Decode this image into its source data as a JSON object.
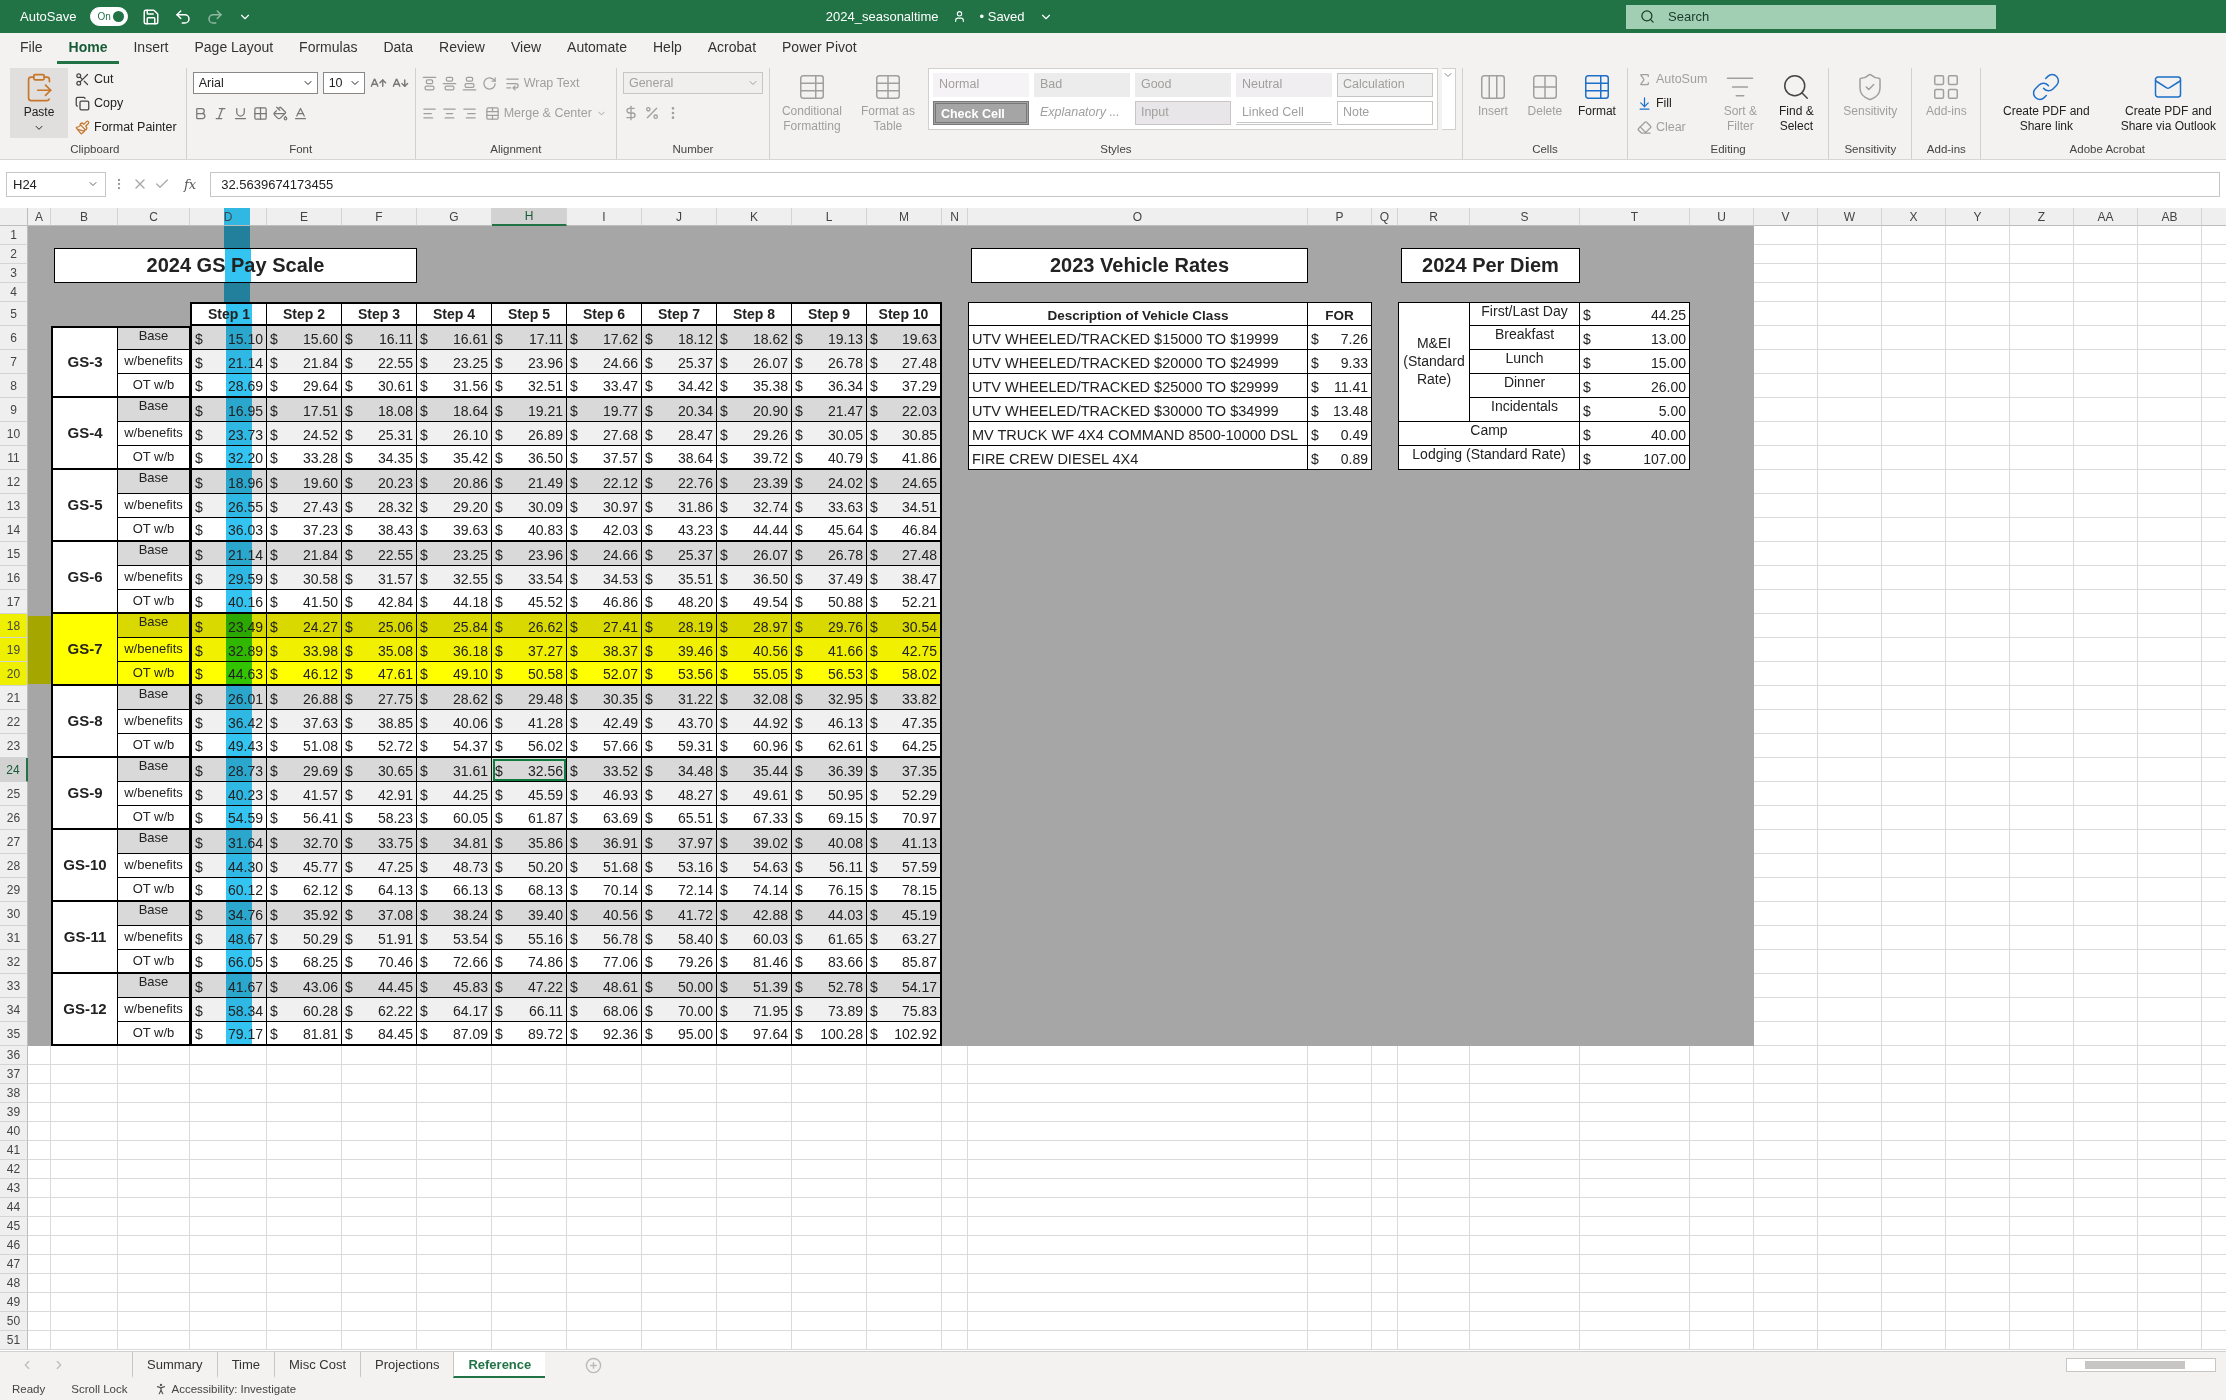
{
  "title_bar": {
    "autosave": "AutoSave",
    "autosave_on": true,
    "toggle_label": "On",
    "filename": "2024_seasonaltime",
    "status": "• Saved",
    "search_placeholder": "Search"
  },
  "ribbon_tabs": [
    {
      "label": "File",
      "selected": false
    },
    {
      "label": "Home",
      "selected": true
    },
    {
      "label": "Insert",
      "selected": false
    },
    {
      "label": "Page Layout",
      "selected": false
    },
    {
      "label": "Formulas",
      "selected": false
    },
    {
      "label": "Data",
      "selected": false
    },
    {
      "label": "Review",
      "selected": false
    },
    {
      "label": "View",
      "selected": false
    },
    {
      "label": "Automate",
      "selected": false
    },
    {
      "label": "Help",
      "selected": false
    },
    {
      "label": "Acrobat",
      "selected": false
    },
    {
      "label": "Power Pivot",
      "selected": false
    }
  ],
  "clipboard": {
    "label": "Clipboard",
    "paste": "Paste",
    "items": [
      {
        "kind": "cut",
        "label": "Cut"
      },
      {
        "kind": "copy",
        "label": "Copy"
      },
      {
        "kind": "painter",
        "label": "Format Painter"
      }
    ]
  },
  "font": {
    "label": "Font",
    "name": "Arial",
    "size": "10"
  },
  "alignment": {
    "label": "Alignment",
    "wrap": "Wrap Text",
    "merge": "Merge & Center",
    "disabled": true
  },
  "number": {
    "label": "Number",
    "format": "General",
    "disabled": true
  },
  "styles": {
    "label": "Styles",
    "buttons": [
      {
        "kind": "conditional",
        "label": "Conditional Formatting",
        "disabled": true
      },
      {
        "kind": "table",
        "label": "Format as Table",
        "disabled": true
      }
    ],
    "gallery": [
      {
        "kind": "normal",
        "label": "Normal"
      },
      {
        "kind": "bad",
        "label": "Bad"
      },
      {
        "kind": "good",
        "label": "Good"
      },
      {
        "kind": "neutral",
        "label": "Neutral"
      },
      {
        "kind": "calculation",
        "label": "Calculation"
      },
      {
        "kind": "check",
        "label": "Check Cell"
      },
      {
        "kind": "explanatory",
        "label": "Explanatory ..."
      },
      {
        "kind": "input",
        "label": "Input"
      },
      {
        "kind": "linked",
        "label": "Linked Cell"
      },
      {
        "kind": "note",
        "label": "Note"
      }
    ]
  },
  "cells": {
    "label": "Cells",
    "buttons": [
      {
        "kind": "insert",
        "label": "Insert",
        "disabled": true
      },
      {
        "kind": "delete",
        "label": "Delete",
        "disabled": true
      },
      {
        "kind": "format",
        "label": "Format",
        "disabled": false
      }
    ]
  },
  "editing": {
    "label": "Editing",
    "items": [
      {
        "kind": "autosum",
        "label": "AutoSum",
        "disabled": true
      },
      {
        "kind": "fill",
        "label": "Fill",
        "disabled": false
      },
      {
        "kind": "clear",
        "label": "Clear",
        "disabled": true
      }
    ],
    "buttons": [
      {
        "kind": "sort",
        "label": "Sort & Filter",
        "disabled": true
      },
      {
        "kind": "find",
        "label": "Find & Select",
        "disabled": false
      }
    ]
  },
  "sensitivity": {
    "label": "Sensitivity",
    "button": "Sensitivity",
    "disabled": true
  },
  "addins": {
    "label": "Add-ins",
    "button": "Add-ins",
    "disabled": true
  },
  "acrobat": {
    "label": "Adobe Acrobat",
    "buttons": [
      {
        "kind": "link",
        "label": "Create PDF and Share link"
      },
      {
        "kind": "outlook",
        "label": "Create PDF and Share via Outlook"
      }
    ]
  },
  "formula_bar": {
    "name_box": "H24",
    "fx": "fx",
    "value": "32.5639674173455"
  },
  "column_headers": [
    {
      "label": "A",
      "selected": false
    },
    {
      "label": "B",
      "selected": false
    },
    {
      "label": "C",
      "selected": false
    },
    {
      "label": "D",
      "selected": false
    },
    {
      "label": "E",
      "selected": false
    },
    {
      "label": "F",
      "selected": false
    },
    {
      "label": "G",
      "selected": false
    },
    {
      "label": "H",
      "selected": true
    },
    {
      "label": "I",
      "selected": false
    },
    {
      "label": "J",
      "selected": false
    },
    {
      "label": "K",
      "selected": false
    },
    {
      "label": "L",
      "selected": false
    },
    {
      "label": "M",
      "selected": false
    },
    {
      "label": "N",
      "selected": false
    },
    {
      "label": "O",
      "selected": false
    },
    {
      "label": "P",
      "selected": false
    },
    {
      "label": "Q",
      "selected": false
    },
    {
      "label": "R",
      "selected": false
    },
    {
      "label": "S",
      "selected": false
    },
    {
      "label": "T",
      "selected": false
    },
    {
      "label": "U",
      "selected": false
    },
    {
      "label": "V",
      "selected": false
    },
    {
      "label": "W",
      "selected": false
    },
    {
      "label": "X",
      "selected": false
    },
    {
      "label": "Y",
      "selected": false
    },
    {
      "label": "Z",
      "selected": false
    },
    {
      "label": "AA",
      "selected": false
    },
    {
      "label": "AB",
      "selected": false
    }
  ],
  "row_headers": [
    {
      "label": "1",
      "selected": false
    },
    {
      "label": "2",
      "selected": false
    },
    {
      "label": "3",
      "selected": false
    },
    {
      "label": "4",
      "selected": false
    },
    {
      "label": "5",
      "selected": false
    },
    {
      "label": "6",
      "selected": false
    },
    {
      "label": "7",
      "selected": false
    },
    {
      "label": "8",
      "selected": false
    },
    {
      "label": "9",
      "selected": false
    },
    {
      "label": "10",
      "selected": false
    },
    {
      "label": "11",
      "selected": false
    },
    {
      "label": "12",
      "selected": false
    },
    {
      "label": "13",
      "selected": false
    },
    {
      "label": "14",
      "selected": false
    },
    {
      "label": "15",
      "selected": false
    },
    {
      "label": "16",
      "selected": false
    },
    {
      "label": "17",
      "selected": false
    },
    {
      "label": "18",
      "selected": false
    },
    {
      "label": "19",
      "selected": false
    },
    {
      "label": "20",
      "selected": false
    },
    {
      "label": "21",
      "selected": false
    },
    {
      "label": "22",
      "selected": false
    },
    {
      "label": "23",
      "selected": false
    },
    {
      "label": "24",
      "selected": true
    },
    {
      "label": "25",
      "selected": false
    },
    {
      "label": "26",
      "selected": false
    },
    {
      "label": "27",
      "selected": false
    },
    {
      "label": "28",
      "selected": false
    },
    {
      "label": "29",
      "selected": false
    },
    {
      "label": "30",
      "selected": false
    },
    {
      "label": "31",
      "selected": false
    },
    {
      "label": "32",
      "selected": false
    },
    {
      "label": "33",
      "selected": false
    },
    {
      "label": "34",
      "selected": false
    },
    {
      "label": "35",
      "selected": false
    },
    {
      "label": "36",
      "selected": false
    },
    {
      "label": "37",
      "selected": false
    },
    {
      "label": "38",
      "selected": false
    },
    {
      "label": "39",
      "selected": false
    },
    {
      "label": "40",
      "selected": false
    },
    {
      "label": "41",
      "selected": false
    },
    {
      "label": "42",
      "selected": false
    },
    {
      "label": "43",
      "selected": false
    },
    {
      "label": "44",
      "selected": false
    },
    {
      "label": "45",
      "selected": false
    },
    {
      "label": "46",
      "selected": false
    },
    {
      "label": "47",
      "selected": false
    },
    {
      "label": "48",
      "selected": false
    },
    {
      "label": "49",
      "selected": false
    },
    {
      "label": "50",
      "selected": false
    },
    {
      "label": "51",
      "selected": false
    }
  ],
  "pay_scale": {
    "title": "2024 GS Pay Scale",
    "steps": [
      {
        "label": "Step 1",
        "highlighted": true
      },
      {
        "label": "Step 2",
        "highlighted": false
      },
      {
        "label": "Step 3",
        "highlighted": false
      },
      {
        "label": "Step 4",
        "highlighted": false
      },
      {
        "label": "Step 5",
        "highlighted": false
      },
      {
        "label": "Step 6",
        "highlighted": false
      },
      {
        "label": "Step 7",
        "highlighted": false
      },
      {
        "label": "Step 8",
        "highlighted": false
      },
      {
        "label": "Step 9",
        "highlighted": false
      },
      {
        "label": "Step 10",
        "highlighted": false
      }
    ],
    "grades": [
      {
        "grade": "GS-3",
        "highlighted": false,
        "rows": [
          {
            "kind": "base",
            "label": "Base",
            "values": [
              "$ 15.10",
              "$ 15.60",
              "$ 16.11",
              "$ 16.61",
              "$ 17.11",
              "$ 17.62",
              "$ 18.12",
              "$ 18.62",
              "$ 19.13",
              "$ 19.63"
            ]
          },
          {
            "kind": "benefits",
            "label": "w/benefits",
            "values": [
              "$ 21.14",
              "$ 21.84",
              "$ 22.55",
              "$ 23.25",
              "$ 23.96",
              "$ 24.66",
              "$ 25.37",
              "$ 26.07",
              "$ 26.78",
              "$ 27.48"
            ]
          },
          {
            "kind": "overtime",
            "label": "OT w/b",
            "values": [
              "$ 28.69",
              "$ 29.64",
              "$ 30.61",
              "$ 31.56",
              "$ 32.51",
              "$ 33.47",
              "$ 34.42",
              "$ 35.38",
              "$ 36.34",
              "$ 37.29"
            ]
          }
        ]
      },
      {
        "grade": "GS-4",
        "highlighted": false,
        "rows": [
          {
            "kind": "base",
            "label": "Base",
            "values": [
              "$ 16.95",
              "$ 17.51",
              "$ 18.08",
              "$ 18.64",
              "$ 19.21",
              "$ 19.77",
              "$ 20.34",
              "$ 20.90",
              "$ 21.47",
              "$ 22.03"
            ]
          },
          {
            "kind": "benefits",
            "label": "w/benefits",
            "values": [
              "$ 23.73",
              "$ 24.52",
              "$ 25.31",
              "$ 26.10",
              "$ 26.89",
              "$ 27.68",
              "$ 28.47",
              "$ 29.26",
              "$ 30.05",
              "$ 30.85"
            ]
          },
          {
            "kind": "overtime",
            "label": "OT w/b",
            "values": [
              "$ 32.20",
              "$ 33.28",
              "$ 34.35",
              "$ 35.42",
              "$ 36.50",
              "$ 37.57",
              "$ 38.64",
              "$ 39.72",
              "$ 40.79",
              "$ 41.86"
            ]
          }
        ]
      },
      {
        "grade": "GS-5",
        "highlighted": false,
        "rows": [
          {
            "kind": "base",
            "label": "Base",
            "values": [
              "$ 18.96",
              "$ 19.60",
              "$ 20.23",
              "$ 20.86",
              "$ 21.49",
              "$ 22.12",
              "$ 22.76",
              "$ 23.39",
              "$ 24.02",
              "$ 24.65"
            ]
          },
          {
            "kind": "benefits",
            "label": "w/benefits",
            "values": [
              "$ 26.55",
              "$ 27.43",
              "$ 28.32",
              "$ 29.20",
              "$ 30.09",
              "$ 30.97",
              "$ 31.86",
              "$ 32.74",
              "$ 33.63",
              "$ 34.51"
            ]
          },
          {
            "kind": "overtime",
            "label": "OT w/b",
            "values": [
              "$ 36.03",
              "$ 37.23",
              "$ 38.43",
              "$ 39.63",
              "$ 40.83",
              "$ 42.03",
              "$ 43.23",
              "$ 44.44",
              "$ 45.64",
              "$ 46.84"
            ]
          }
        ]
      },
      {
        "grade": "GS-6",
        "highlighted": false,
        "rows": [
          {
            "kind": "base",
            "label": "Base",
            "values": [
              "$ 21.14",
              "$ 21.84",
              "$ 22.55",
              "$ 23.25",
              "$ 23.96",
              "$ 24.66",
              "$ 25.37",
              "$ 26.07",
              "$ 26.78",
              "$ 27.48"
            ]
          },
          {
            "kind": "benefits",
            "label": "w/benefits",
            "values": [
              "$ 29.59",
              "$ 30.58",
              "$ 31.57",
              "$ 32.55",
              "$ 33.54",
              "$ 34.53",
              "$ 35.51",
              "$ 36.50",
              "$ 37.49",
              "$ 38.47"
            ]
          },
          {
            "kind": "overtime",
            "label": "OT w/b",
            "values": [
              "$ 40.16",
              "$ 41.50",
              "$ 42.84",
              "$ 44.18",
              "$ 45.52",
              "$ 46.86",
              "$ 48.20",
              "$ 49.54",
              "$ 50.88",
              "$ 52.21"
            ]
          }
        ]
      },
      {
        "grade": "GS-7",
        "highlighted": true,
        "rows": [
          {
            "kind": "base",
            "label": "Base",
            "values": [
              "$ 23.49",
              "$ 24.27",
              "$ 25.06",
              "$ 25.84",
              "$ 26.62",
              "$ 27.41",
              "$ 28.19",
              "$ 28.97",
              "$ 29.76",
              "$ 30.54"
            ]
          },
          {
            "kind": "benefits",
            "label": "w/benefits",
            "values": [
              "$ 32.89",
              "$ 33.98",
              "$ 35.08",
              "$ 36.18",
              "$ 37.27",
              "$ 38.37",
              "$ 39.46",
              "$ 40.56",
              "$ 41.66",
              "$ 42.75"
            ]
          },
          {
            "kind": "overtime",
            "label": "OT w/b",
            "values": [
              "$ 44.63",
              "$ 46.12",
              "$ 47.61",
              "$ 49.10",
              "$ 50.58",
              "$ 52.07",
              "$ 53.56",
              "$ 55.05",
              "$ 56.53",
              "$ 58.02"
            ]
          }
        ]
      },
      {
        "grade": "GS-8",
        "highlighted": false,
        "rows": [
          {
            "kind": "base",
            "label": "Base",
            "values": [
              "$ 26.01",
              "$ 26.88",
              "$ 27.75",
              "$ 28.62",
              "$ 29.48",
              "$ 30.35",
              "$ 31.22",
              "$ 32.08",
              "$ 32.95",
              "$ 33.82"
            ]
          },
          {
            "kind": "benefits",
            "label": "w/benefits",
            "values": [
              "$ 36.42",
              "$ 37.63",
              "$ 38.85",
              "$ 40.06",
              "$ 41.28",
              "$ 42.49",
              "$ 43.70",
              "$ 44.92",
              "$ 46.13",
              "$ 47.35"
            ]
          },
          {
            "kind": "overtime",
            "label": "OT w/b",
            "values": [
              "$ 49.43",
              "$ 51.08",
              "$ 52.72",
              "$ 54.37",
              "$ 56.02",
              "$ 57.66",
              "$ 59.31",
              "$ 60.96",
              "$ 62.61",
              "$ 64.25"
            ]
          }
        ]
      },
      {
        "grade": "GS-9",
        "highlighted": false,
        "rows": [
          {
            "kind": "base",
            "label": "Base",
            "values": [
              "$ 28.73",
              "$ 29.69",
              "$ 30.65",
              "$ 31.61",
              "$ 32.56",
              "$ 33.52",
              "$ 34.48",
              "$ 35.44",
              "$ 36.39",
              "$ 37.35"
            ]
          },
          {
            "kind": "benefits",
            "label": "w/benefits",
            "values": [
              "$ 40.23",
              "$ 41.57",
              "$ 42.91",
              "$ 44.25",
              "$ 45.59",
              "$ 46.93",
              "$ 48.27",
              "$ 49.61",
              "$ 50.95",
              "$ 52.29"
            ]
          },
          {
            "kind": "overtime",
            "label": "OT w/b",
            "values": [
              "$ 54.59",
              "$ 56.41",
              "$ 58.23",
              "$ 60.05",
              "$ 61.87",
              "$ 63.69",
              "$ 65.51",
              "$ 67.33",
              "$ 69.15",
              "$ 70.97"
            ]
          }
        ]
      },
      {
        "grade": "GS-10",
        "highlighted": false,
        "rows": [
          {
            "kind": "base",
            "label": "Base",
            "values": [
              "$ 31.64",
              "$ 32.70",
              "$ 33.75",
              "$ 34.81",
              "$ 35.86",
              "$ 36.91",
              "$ 37.97",
              "$ 39.02",
              "$ 40.08",
              "$ 41.13"
            ]
          },
          {
            "kind": "benefits",
            "label": "w/benefits",
            "values": [
              "$ 44.30",
              "$ 45.77",
              "$ 47.25",
              "$ 48.73",
              "$ 50.20",
              "$ 51.68",
              "$ 53.16",
              "$ 54.63",
              "$ 56.11",
              "$ 57.59"
            ]
          },
          {
            "kind": "overtime",
            "label": "OT w/b",
            "values": [
              "$ 60.12",
              "$ 62.12",
              "$ 64.13",
              "$ 66.13",
              "$ 68.13",
              "$ 70.14",
              "$ 72.14",
              "$ 74.14",
              "$ 76.15",
              "$ 78.15"
            ]
          }
        ]
      },
      {
        "grade": "GS-11",
        "highlighted": false,
        "rows": [
          {
            "kind": "base",
            "label": "Base",
            "values": [
              "$ 34.76",
              "$ 35.92",
              "$ 37.08",
              "$ 38.24",
              "$ 39.40",
              "$ 40.56",
              "$ 41.72",
              "$ 42.88",
              "$ 44.03",
              "$ 45.19"
            ]
          },
          {
            "kind": "benefits",
            "label": "w/benefits",
            "values": [
              "$ 48.67",
              "$ 50.29",
              "$ 51.91",
              "$ 53.54",
              "$ 55.16",
              "$ 56.78",
              "$ 58.40",
              "$ 60.03",
              "$ 61.65",
              "$ 63.27"
            ]
          },
          {
            "kind": "overtime",
            "label": "OT w/b",
            "values": [
              "$ 66.05",
              "$ 68.25",
              "$ 70.46",
              "$ 72.66",
              "$ 74.86",
              "$ 77.06",
              "$ 79.26",
              "$ 81.46",
              "$ 83.66",
              "$ 85.87"
            ]
          }
        ]
      },
      {
        "grade": "GS-12",
        "highlighted": false,
        "rows": [
          {
            "kind": "base",
            "label": "Base",
            "values": [
              "$ 41.67",
              "$ 43.06",
              "$ 44.45",
              "$ 45.83",
              "$ 47.22",
              "$ 48.61",
              "$ 50.00",
              "$ 51.39",
              "$ 52.78",
              "$ 54.17"
            ]
          },
          {
            "kind": "benefits",
            "label": "w/benefits",
            "values": [
              "$ 58.34",
              "$ 60.28",
              "$ 62.22",
              "$ 64.17",
              "$ 66.11",
              "$ 68.06",
              "$ 70.00",
              "$ 71.95",
              "$ 73.89",
              "$ 75.83"
            ]
          },
          {
            "kind": "overtime",
            "label": "OT w/b",
            "values": [
              "$ 79.17",
              "$ 81.81",
              "$ 84.45",
              "$ 87.09",
              "$ 89.72",
              "$ 92.36",
              "$ 95.00",
              "$ 97.64",
              "$ 100.28",
              "$ 102.92"
            ]
          }
        ]
      }
    ]
  },
  "vehicle_rates": {
    "title": "2023 Vehicle Rates",
    "columns": [
      "Description of Vehicle Class",
      "FOR"
    ],
    "rows": [
      {
        "description": "UTV WHEELED/TRACKED $15000 TO $19999",
        "rate": "$ 7.26"
      },
      {
        "description": "UTV WHEELED/TRACKED $20000 TO $24999",
        "rate": "$ 9.33"
      },
      {
        "description": "UTV WHEELED/TRACKED $25000 TO $29999",
        "rate": "$ 11.41"
      },
      {
        "description": "UTV WHEELED/TRACKED $30000 TO $34999",
        "rate": "$ 13.48"
      },
      {
        "description": "MV TRUCK WF 4X4 COMMAND 8500-10000 DSL",
        "rate": "$ 0.49"
      },
      {
        "description": "FIRE CREW DIESEL 4X4",
        "rate": "$ 0.89"
      }
    ]
  },
  "per_diem": {
    "title": "2024 Per Diem",
    "group": "M&EI (Standard Rate)",
    "meals": [
      {
        "label": "First/Last Day",
        "amount": "$ 44.25"
      },
      {
        "label": "Breakfast",
        "amount": "$ 13.00"
      },
      {
        "label": "Lunch",
        "amount": "$ 15.00"
      },
      {
        "label": "Dinner",
        "amount": "$ 26.00"
      },
      {
        "label": "Incidentals",
        "amount": "$ 5.00"
      }
    ],
    "other": [
      {
        "label": "Camp",
        "amount": "$ 40.00"
      },
      {
        "label": "Lodging (Standard Rate)",
        "amount": "$ 107.00"
      }
    ]
  },
  "sheet_tabs": [
    {
      "label": "Summary",
      "selected": false
    },
    {
      "label": "Time",
      "selected": false
    },
    {
      "label": "Misc Cost",
      "selected": false
    },
    {
      "label": "Projections",
      "selected": false
    },
    {
      "label": "Reference",
      "selected": true
    }
  ],
  "status_bar": {
    "ready": "Ready",
    "scroll_lock": "Scroll Lock",
    "accessibility": "Accessibility: Investigate"
  }
}
